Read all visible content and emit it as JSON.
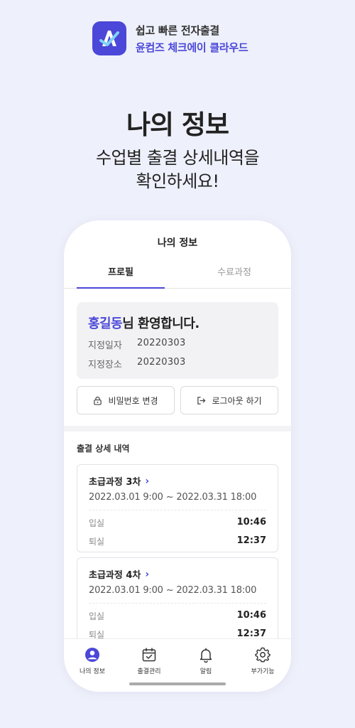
{
  "brand": {
    "line1": "쉽고 빠른 전자출결",
    "line2": "윤컴즈 체크에이 클라우드",
    "logo_icon": "checka-logo-icon",
    "accent_color": "#4b47d8"
  },
  "hero": {
    "title": "나의 정보",
    "subtitle_line1": "수업별 출결 상세내역을",
    "subtitle_line2": "확인하세요!"
  },
  "screen": {
    "title": "나의 정보",
    "tabs": [
      {
        "label": "프로필",
        "active": true
      },
      {
        "label": "수료과정",
        "active": false
      }
    ],
    "profile": {
      "name": "홍길동",
      "greeting": "님 환영합니다.",
      "rows": [
        {
          "label": "지정일자",
          "value": "20220303"
        },
        {
          "label": "지정장소",
          "value": "20220303"
        }
      ]
    },
    "buttons": {
      "password_label": "비밀번호 변경",
      "password_icon": "lock-icon",
      "logout_label": "로그아웃 하기",
      "logout_icon": "logout-icon"
    },
    "attendance": {
      "section_title": "출결 상세 내역",
      "courses": [
        {
          "name": "초급과정 3차",
          "chevron": "›",
          "period": "2022.03.01 9:00 ~ 2022.03.31 18:00",
          "in_label": "입실",
          "in_time": "10:46",
          "out_label": "퇴실",
          "out_time": "12:37"
        },
        {
          "name": "초급과정 4차",
          "chevron": "›",
          "period": "2022.03.01 9:00 ~ 2022.03.31 18:00",
          "in_label": "입실",
          "in_time": "10:46",
          "out_label": "퇴실",
          "out_time": "12:37"
        }
      ]
    },
    "nav": [
      {
        "label": "나의 정보",
        "icon": "user-icon",
        "active": true
      },
      {
        "label": "출결관리",
        "icon": "calendar-check-icon",
        "active": false
      },
      {
        "label": "알림",
        "icon": "bell-icon",
        "active": false
      },
      {
        "label": "부가기능",
        "icon": "gear-icon",
        "active": false
      }
    ]
  }
}
